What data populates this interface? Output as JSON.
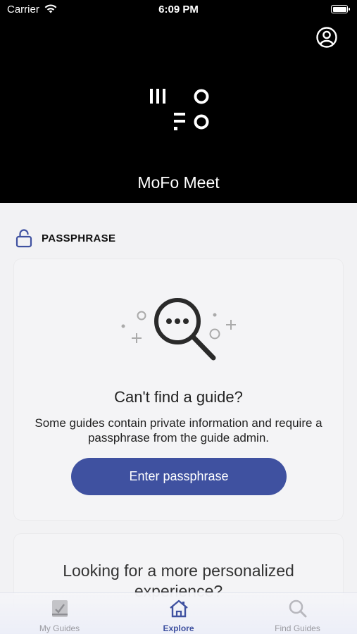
{
  "status_bar": {
    "carrier": "Carrier",
    "time": "6:09 PM"
  },
  "header": {
    "app_title": "MoFo Meet",
    "profile_icon": "person-circle-icon",
    "logo": "mofo-logo"
  },
  "section": {
    "label": "PASSPHRASE",
    "icon": "lock-icon"
  },
  "passphrase_card": {
    "illustration": "magnifier-with-dots-icon",
    "heading": "Can't find a guide?",
    "description": "Some guides contain private information and require a passphrase from the guide admin.",
    "button_label": "Enter passphrase"
  },
  "personalized_card": {
    "heading": "Looking for a more personalized experience?"
  },
  "tabs": [
    {
      "label": "My Guides",
      "icon": "checklist-icon",
      "active": false
    },
    {
      "label": "Explore",
      "icon": "house-icon",
      "active": true
    },
    {
      "label": "Find Guides",
      "icon": "search-icon",
      "active": false
    }
  ],
  "colors": {
    "accent": "#3f51a0",
    "header_bg": "#000000",
    "page_bg": "#f2f2f4"
  }
}
